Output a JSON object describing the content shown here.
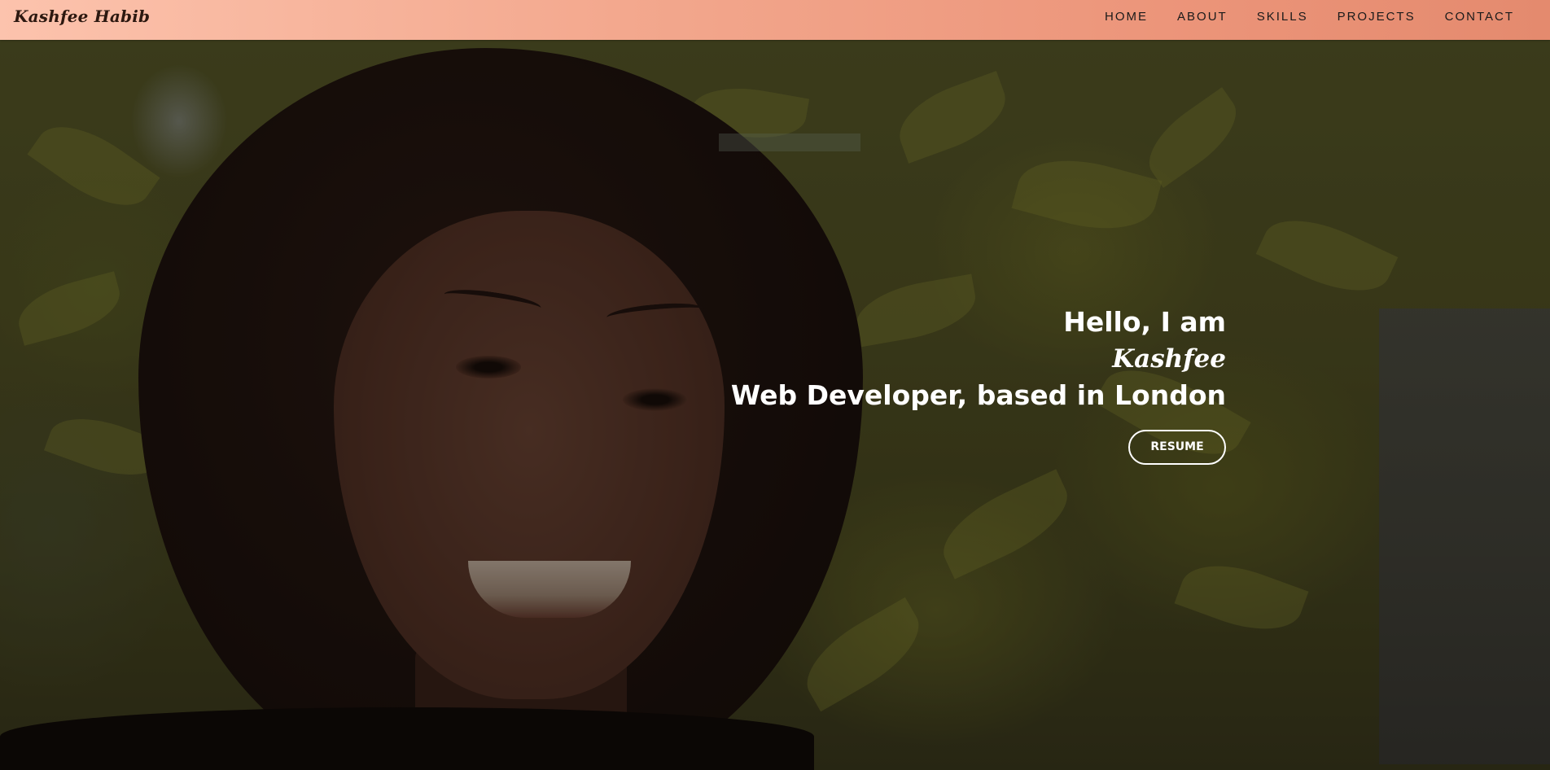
{
  "nav": {
    "brand": "Kashfee Habib",
    "links": [
      {
        "label": "HOME"
      },
      {
        "label": "ABOUT"
      },
      {
        "label": "SKILLS"
      },
      {
        "label": "PROJECTS"
      },
      {
        "label": "CONTACT"
      }
    ]
  },
  "hero": {
    "greeting": "Hello, I am",
    "name": "Kashfee",
    "tagline": "Web Developer, based in London",
    "resume_label": "RESUME"
  },
  "colors": {
    "navbar_start": "#fcc3ad",
    "navbar_end": "#e48a6e",
    "hero_text": "#ffffff"
  }
}
